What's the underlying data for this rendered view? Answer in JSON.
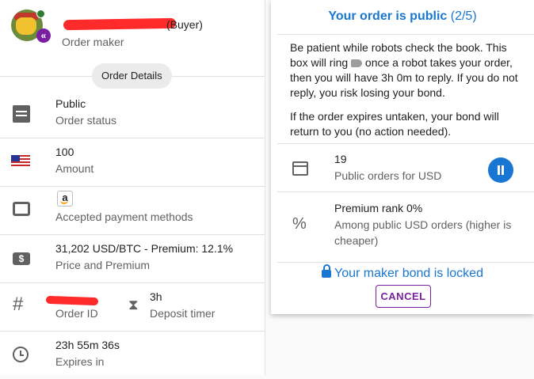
{
  "maker": {
    "role_suffix": "(Buyer)",
    "role_label": "Order maker",
    "type_badge": "«"
  },
  "details_chip": "Order Details",
  "rows": {
    "status": {
      "value": "Public",
      "label": "Order status"
    },
    "amount": {
      "value": "100",
      "label": "Amount"
    },
    "payment": {
      "badge": "a",
      "label": "Accepted payment methods"
    },
    "price": {
      "value": "31,202 USD/BTC - Premium: 12.1%",
      "label": "Price and Premium"
    },
    "order_id": {
      "label": "Order ID"
    },
    "deposit": {
      "value": "3h",
      "label": "Deposit timer"
    },
    "expires": {
      "value": "23h 55m 36s",
      "label": "Expires in"
    }
  },
  "dialog": {
    "title": "Your order is public",
    "step": "(2/5)",
    "msg1_a": "Be patient while robots check the book. This box will ring",
    "msg1_b": "once a robot takes your order, then you will have 3h 0m to reply. If you do not reply, you risk losing your bond.",
    "msg2": "If the order expires untaken, your bond will return to you (no action needed).",
    "public_orders": {
      "value": "19",
      "label": "Public orders for USD"
    },
    "premium_rank": {
      "value": "Premium rank 0%",
      "label": "Among public USD orders (higher is cheaper)"
    },
    "bond_status": "Your maker bond is locked",
    "cancel_label": "CANCEL"
  },
  "icons": [
    "order-status-icon",
    "us-flag-icon",
    "payment-methods-icon",
    "price-icon",
    "hash-icon",
    "hourglass-icon",
    "clock-icon",
    "bell-icon",
    "store-icon",
    "pause-icon",
    "percent-icon",
    "lock-icon"
  ],
  "colors": {
    "primary": "#1976d2",
    "secondary": "#7b1fa2",
    "redaction": "#ff2a2a"
  }
}
